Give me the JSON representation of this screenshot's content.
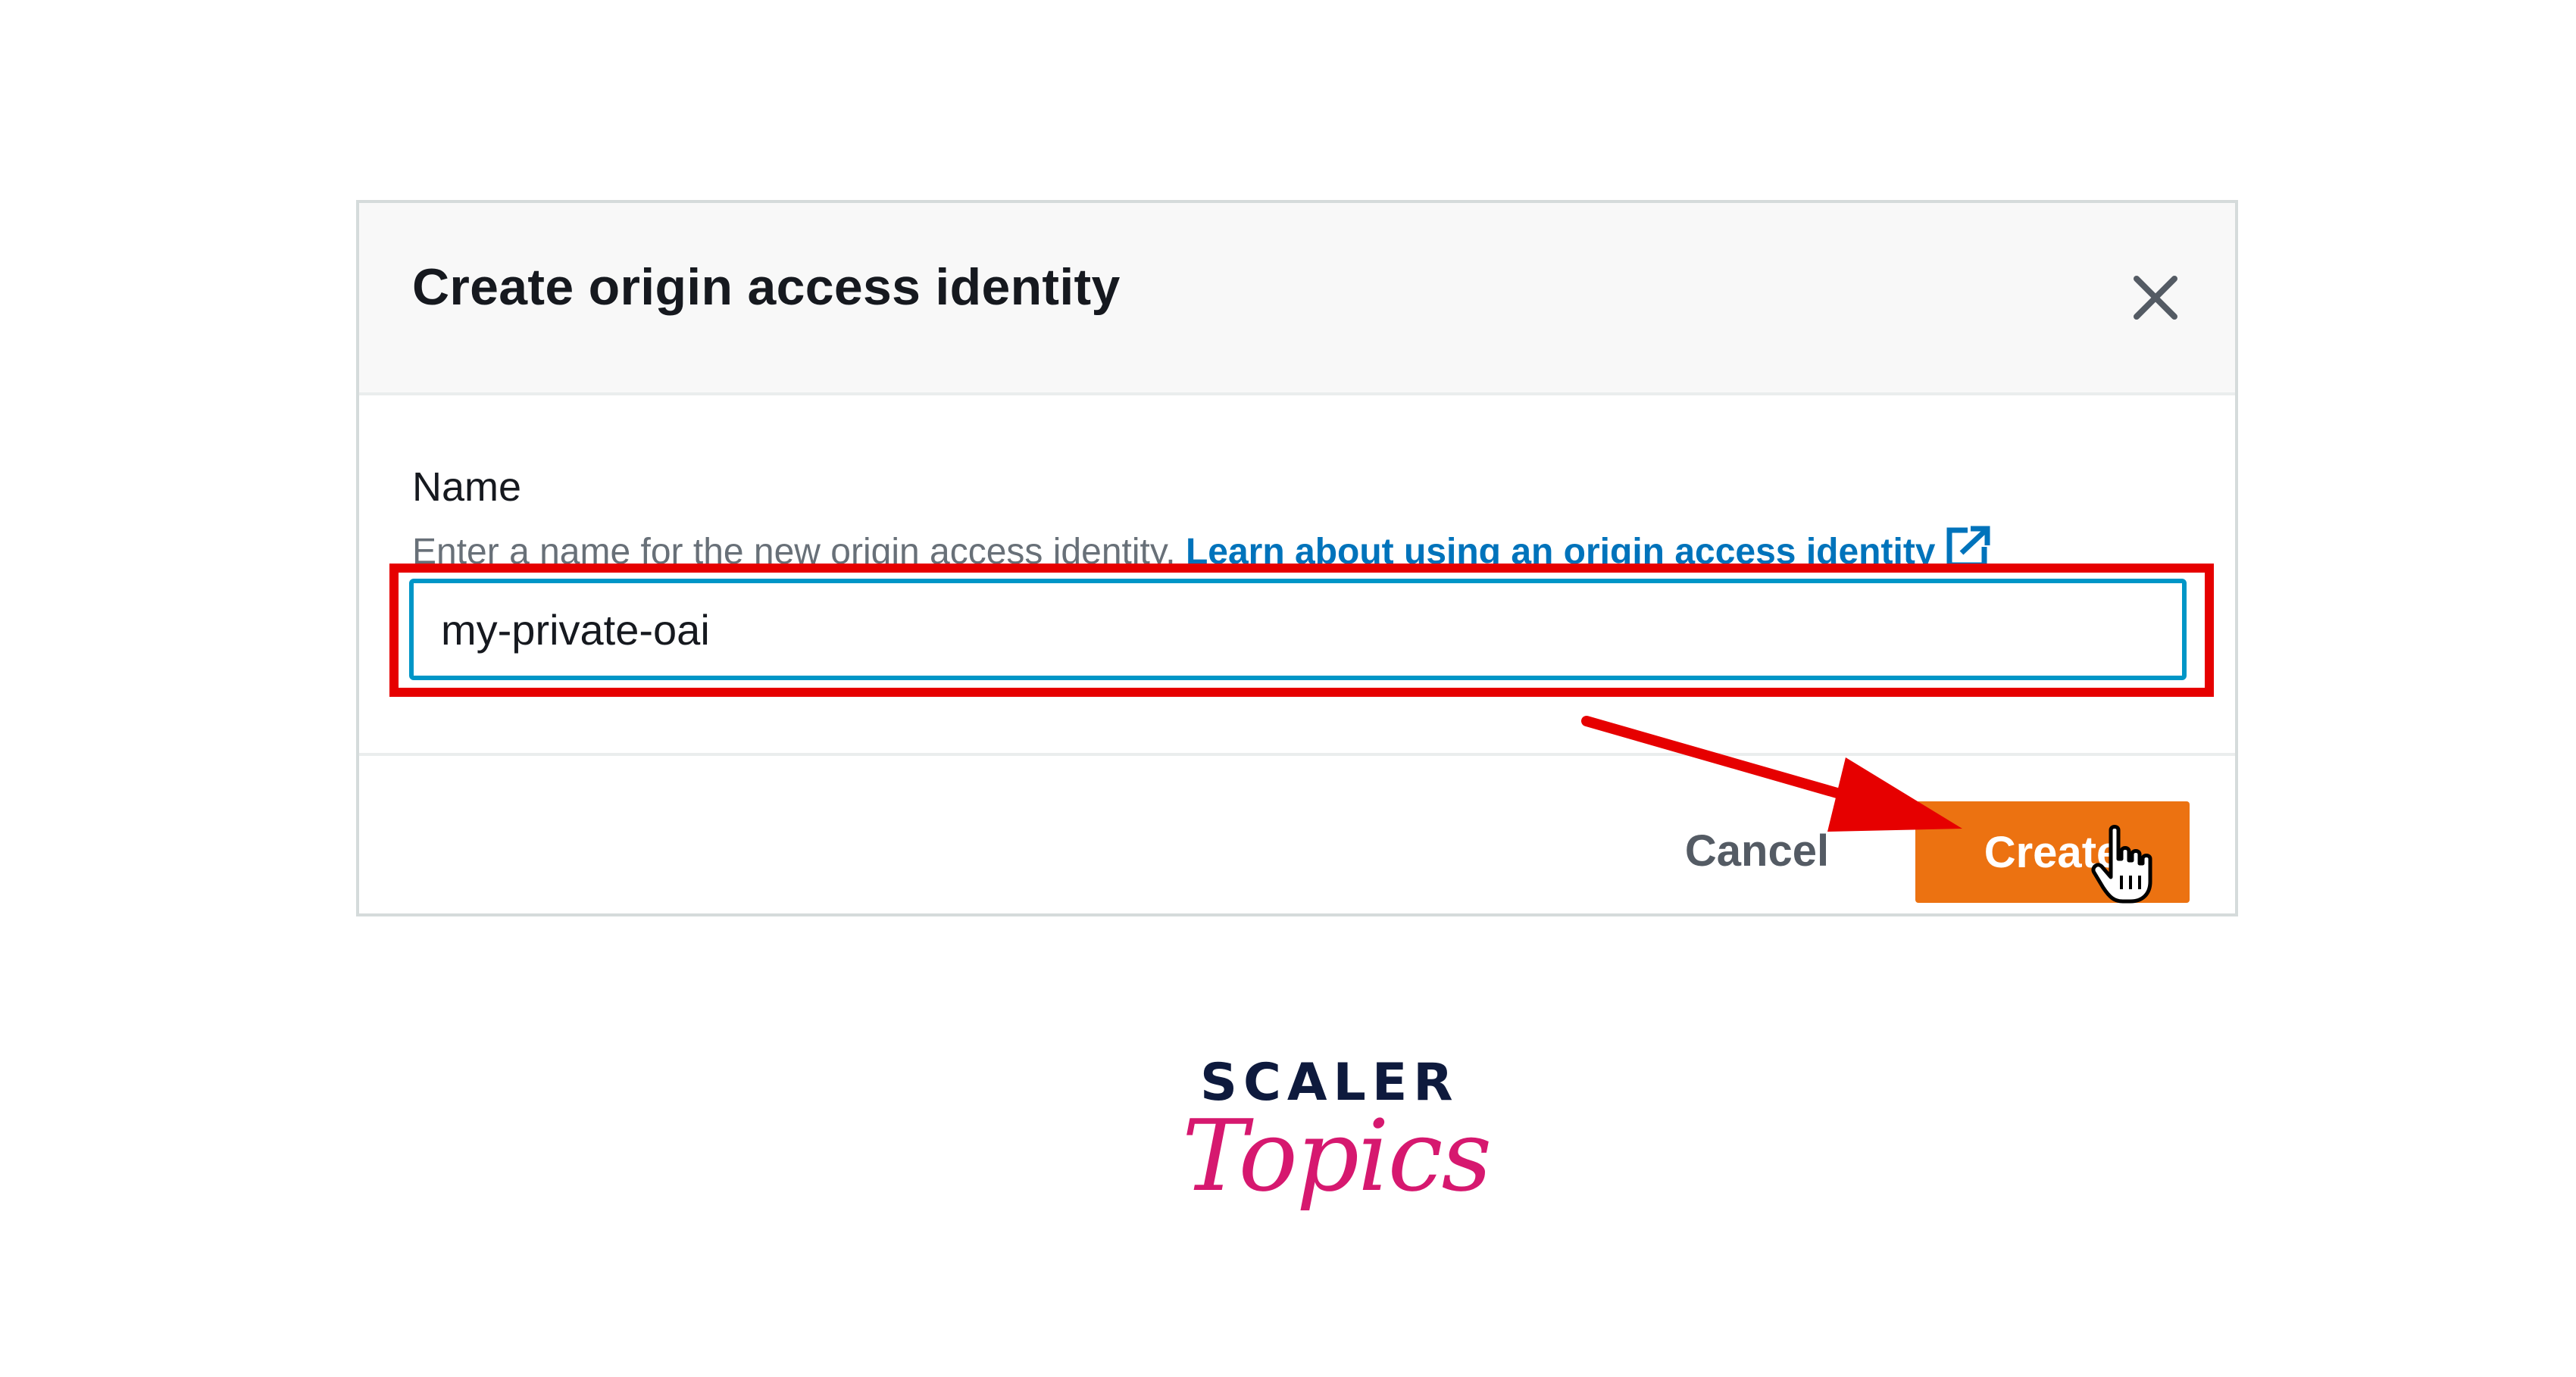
{
  "modal": {
    "title": "Create origin access identity",
    "close_icon": "close-icon"
  },
  "field": {
    "label": "Name",
    "description": "Enter a name for the new origin access identity.",
    "learn_link": "Learn about using an origin access identity",
    "link_icon": "external-link-icon",
    "value": "my-private-oai"
  },
  "footer": {
    "cancel_label": "Cancel",
    "create_label": "Create"
  },
  "logo": {
    "line1": "SCALER",
    "line2": "Topics"
  },
  "colors": {
    "primary_button": "#ec7211",
    "link": "#0073bb",
    "input_focus": "#0096c7",
    "annotation": "#e60000",
    "logo_navy": "#0e1a3d",
    "logo_pink": "#d6186f"
  }
}
